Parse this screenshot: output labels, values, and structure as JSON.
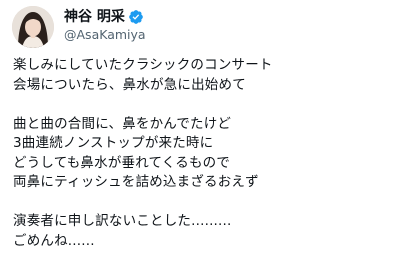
{
  "tweet": {
    "author": {
      "display_name": "神谷 明采",
      "handle": "@AsaKamiya",
      "verified_icon": "verified-badge-icon",
      "verified_color": "#1d9bf0"
    },
    "paragraphs": [
      [
        "楽しみにしていたクラシックのコンサート",
        "会場についたら、鼻水が急に出始めて"
      ],
      [
        "曲と曲の合間に、鼻をかんでたけど",
        "3曲連続ノンストップが来た時に",
        "どうしても鼻水が垂れてくるもので",
        "両鼻にティッシュを詰め込まざるおえず"
      ],
      [
        "演奏者に申し訳ないことした.........",
        "ごめんね......"
      ]
    ]
  }
}
